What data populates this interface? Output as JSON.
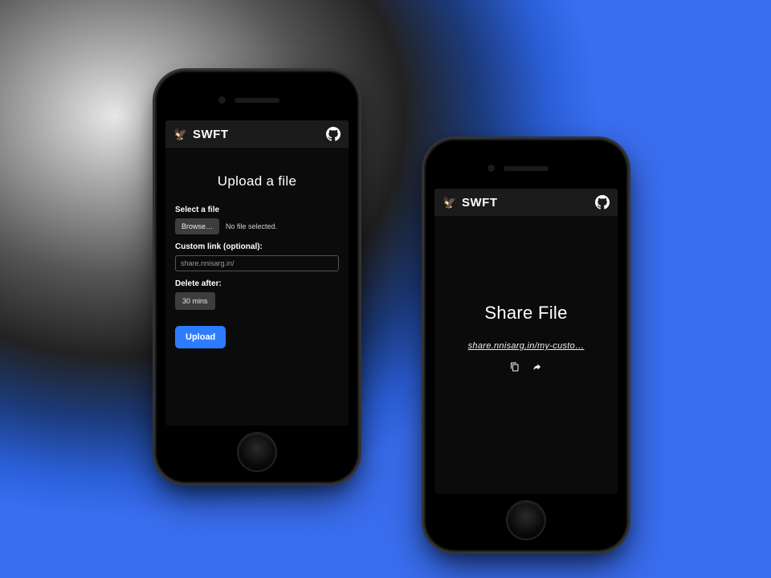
{
  "phones": {
    "left": {
      "header": {
        "brand": "SWFT"
      },
      "title": "Upload a file",
      "select_label": "Select a file",
      "browse_label": "Browse…",
      "file_status": "No file selected.",
      "custom_link_label": "Custom link (optional):",
      "custom_link_placeholder": "share.nnisarg.in/",
      "delete_after_label": "Delete after:",
      "delete_after_value": "30 mins",
      "upload_label": "Upload"
    },
    "right": {
      "header": {
        "brand": "SWFT"
      },
      "title": "Share File",
      "share_url": "share.nnisarg.in/my-custo…"
    }
  },
  "icons": {
    "brand": "eagle-icon",
    "github": "github-icon",
    "copy": "copy-icon",
    "share": "share-arrow-icon"
  },
  "colors": {
    "accent": "#2d7cff",
    "bg_dark": "#0b0b0b",
    "header_bg": "#1b1b1b"
  }
}
